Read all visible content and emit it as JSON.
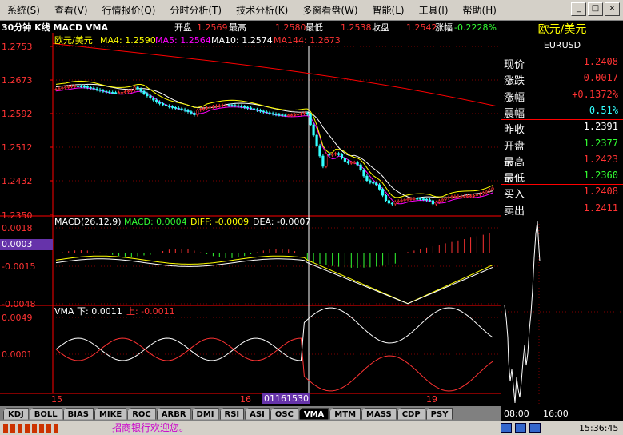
{
  "menu": [
    "系统(S)",
    "查看(V)",
    "行情报价(Q)",
    "分时分析(T)",
    "技术分析(K)",
    "多窗看盘(W)",
    "智能(L)",
    "工具(I)",
    "帮助(H)"
  ],
  "window_controls": [
    "_",
    "□",
    "×"
  ],
  "header": {
    "period_title": "30分钟 K线 MACD VMA",
    "open_label": "开盘",
    "open_value": "1.2569",
    "high_label": "最高",
    "high_value": "1.2580",
    "low_label": "最低",
    "low_value": "1.2538",
    "close_label": "收盘",
    "close_value": "1.2542",
    "change_label": "涨幅",
    "change_value": "-0.2228%"
  },
  "main_legend": {
    "name": "欧元/美元",
    "ma4": "MA4: 1.2590",
    "ma5": "MA5: 1.2564",
    "ma10": "MA10: 1.2574",
    "ma144": "MA144: 1.2673"
  },
  "price_axis": [
    "1.2753",
    "1.2673",
    "1.2592",
    "1.2512",
    "1.2432",
    "1.2350"
  ],
  "macd_legend": {
    "title": "MACD(26,12,9)",
    "macd": "MACD: 0.0004",
    "diff": "DIFF: -0.0009",
    "dea": "DEA: -0.0007"
  },
  "macd_axis": [
    "0.0018",
    "0.0003",
    "-0.0015",
    "-0.0048"
  ],
  "vma_legend": {
    "down": "VMA 下: 0.0011",
    "up": "上: -0.0011"
  },
  "vma_axis": [
    "0.0049",
    "0.0001"
  ],
  "date_axis": {
    "d1": "15",
    "d2": "16",
    "cursor": "01161530",
    "d3": "19"
  },
  "quote": {
    "name": "欧元/美元",
    "code": "EURUSD",
    "rows": [
      {
        "label": "现价",
        "value": "1.2408",
        "color": "#ff3333"
      },
      {
        "label": "涨跌",
        "value": "0.0017",
        "color": "#ff3333"
      },
      {
        "label": "涨幅",
        "value": "+0.1372%",
        "color": "#ff3333"
      },
      {
        "label": "震幅",
        "value": "0.51%",
        "color": "#33ffff"
      },
      {
        "label": "昨收",
        "value": "1.2391",
        "color": "#ffffff"
      },
      {
        "label": "开盘",
        "value": "1.2377",
        "color": "#33ff33"
      },
      {
        "label": "最高",
        "value": "1.2423",
        "color": "#ff3333"
      },
      {
        "label": "最低",
        "value": "1.2360",
        "color": "#33ff33"
      },
      {
        "label": "买入",
        "value": "1.2408",
        "color": "#ff3333"
      },
      {
        "label": "卖出",
        "value": "1.2411",
        "color": "#ff3333"
      }
    ],
    "time_axis": [
      "08:00",
      "16:00"
    ]
  },
  "tabs": [
    "KDJ",
    "BOLL",
    "BIAS",
    "MIKE",
    "ROC",
    "ARBR",
    "DMI",
    "RSI",
    "ASI",
    "OSC",
    "VMA",
    "MTM",
    "MASS",
    "CDP",
    "PSY"
  ],
  "active_tab": "VMA",
  "status": {
    "message": "招商银行欢迎您。",
    "time": "15:36:45"
  },
  "colors": {
    "up": "#ff3333",
    "down": "#33ffff",
    "ma4": "#ffff00",
    "ma5": "#ff00ff",
    "ma10": "#ffffff",
    "ma144": "#ff0000",
    "grid": "#800000",
    "axis": "#ff0000"
  }
}
